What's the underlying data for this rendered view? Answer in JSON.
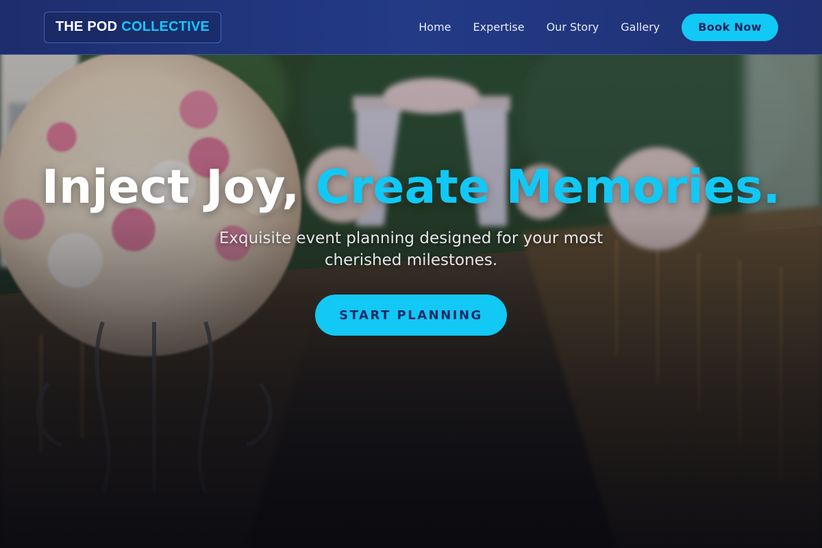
{
  "brand": {
    "name_part1": "THE POD",
    "name_part2": "COLLECTIVE"
  },
  "nav": {
    "links": [
      "Home",
      "Expertise",
      "Our Story",
      "Gallery"
    ],
    "cta_label": "Book Now"
  },
  "hero": {
    "headline_plain": "Inject Joy,",
    "headline_accent": "Create Memories.",
    "subheadline": "Exquisite event planning designed for your most cherished milestones.",
    "cta_label": "START PLANNING",
    "background": "wedding-aisle-flowers-photo"
  },
  "colors": {
    "accent": "#12c8f4",
    "nav_bg": "#1f3073",
    "cta_text": "#1a2a66"
  }
}
